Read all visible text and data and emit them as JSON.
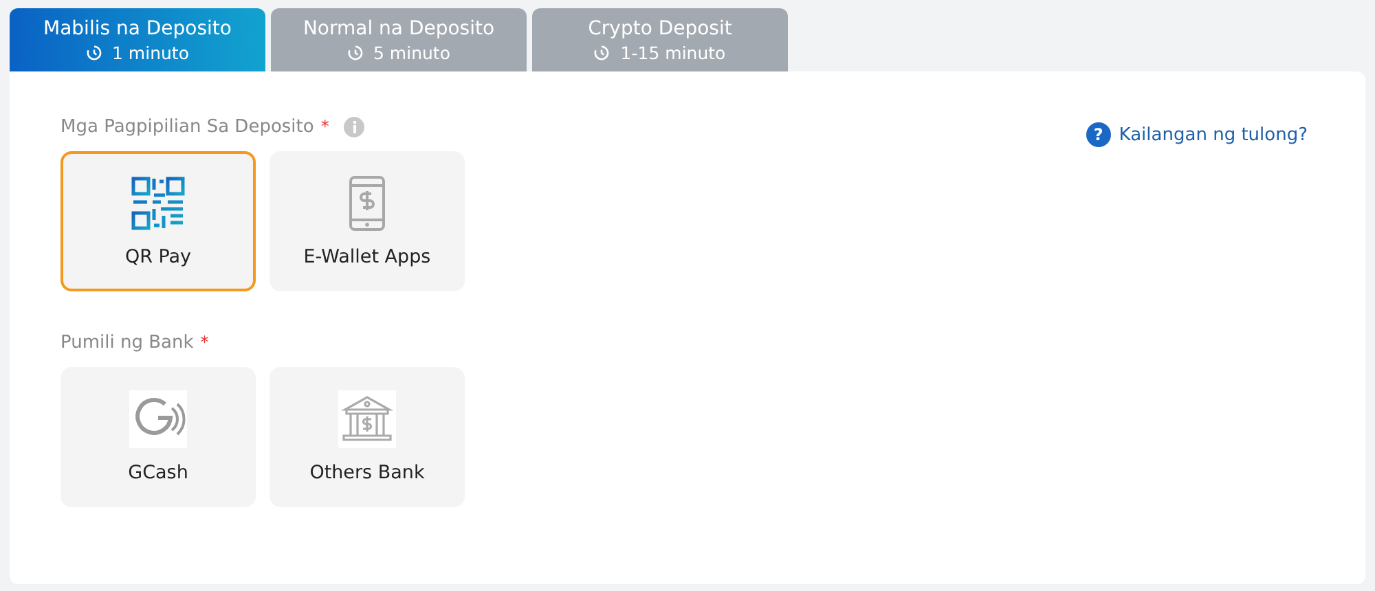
{
  "tabs": [
    {
      "label": "Mabilis na Deposito",
      "time": "1 minuto",
      "selected": true
    },
    {
      "label": "Normal na Deposito",
      "time": "5 minuto",
      "selected": false
    },
    {
      "label": "Crypto Deposit",
      "time": "1-15 minuto",
      "selected": false
    }
  ],
  "help": {
    "icon": "?",
    "label": "Kailangan ng tulong?"
  },
  "sections": [
    {
      "label": "Mga Pagpipilian Sa Deposito",
      "required": "*",
      "info": true,
      "options": [
        {
          "kind": "qr",
          "label": "QR Pay",
          "selected": true
        },
        {
          "kind": "phone",
          "label": "E-Wallet Apps",
          "selected": false
        }
      ]
    },
    {
      "label": "Pumili ng Bank",
      "required": "*",
      "info": false,
      "options": [
        {
          "kind": "gcash",
          "label": "GCash",
          "selected": false
        },
        {
          "kind": "bank",
          "label": "Others Bank",
          "selected": false
        }
      ]
    }
  ]
}
